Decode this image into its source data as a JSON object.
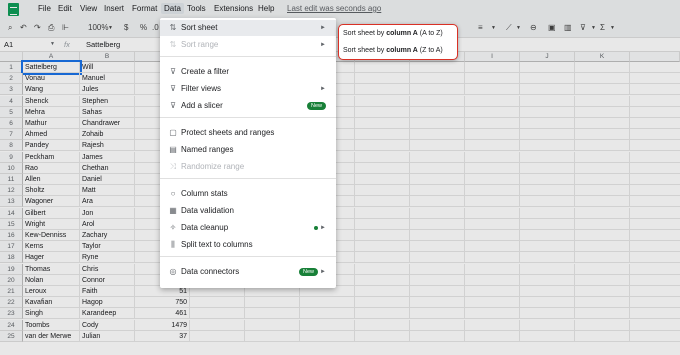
{
  "menubar": {
    "items": [
      "File",
      "Edit",
      "View",
      "Insert",
      "Format",
      "Data",
      "Tools",
      "Extensions",
      "Help"
    ],
    "last_edit": "Last edit was seconds ago"
  },
  "toolbar": {
    "zoom": "100%",
    "currency": "$",
    "percent": "%",
    "decimals": ".0"
  },
  "formula_bar": {
    "cell_ref": "A1",
    "fx": "fx",
    "value": "Sattelberg"
  },
  "grid": {
    "columns": [
      "A",
      "B",
      "C",
      "D",
      "E",
      "F",
      "G",
      "H",
      "I",
      "J",
      "K"
    ],
    "rows": [
      [
        "1",
        "Sattelberg",
        "Will",
        ""
      ],
      [
        "2",
        "Vonau",
        "Manuel",
        ""
      ],
      [
        "3",
        "Wang",
        "Jules",
        ""
      ],
      [
        "4",
        "Shenck",
        "Stephen",
        ""
      ],
      [
        "5",
        "Mehra",
        "Sahas",
        ""
      ],
      [
        "6",
        "Mathur",
        "Chandrawer",
        ""
      ],
      [
        "7",
        "Ahmed",
        "Zohaib",
        ""
      ],
      [
        "8",
        "Pandey",
        "Rajesh",
        ""
      ],
      [
        "9",
        "Peckham",
        "James",
        ""
      ],
      [
        "10",
        "Rao",
        "Chethan",
        ""
      ],
      [
        "11",
        "Allen",
        "Daniel",
        ""
      ],
      [
        "12",
        "Sholtz",
        "Matt",
        ""
      ],
      [
        "13",
        "Wagoner",
        "Ara",
        ""
      ],
      [
        "14",
        "Gilbert",
        "Jon",
        ""
      ],
      [
        "15",
        "Wright",
        "Arol",
        ""
      ],
      [
        "16",
        "Kew-Denniss",
        "Zachary",
        ""
      ],
      [
        "17",
        "Kerns",
        "Taylor",
        ""
      ],
      [
        "18",
        "Hager",
        "Ryne",
        ""
      ],
      [
        "19",
        "Thomas",
        "Chris",
        ""
      ],
      [
        "20",
        "Nolan",
        "Connor",
        "33"
      ],
      [
        "21",
        "Leroux",
        "Faith",
        "51"
      ],
      [
        "22",
        "Kavafian",
        "Hagop",
        "750"
      ],
      [
        "23",
        "Singh",
        "Karandeep",
        "461"
      ],
      [
        "24",
        "Toombs",
        "Cody",
        "1479"
      ],
      [
        "25",
        "van der Merwe",
        "Julian",
        "37"
      ]
    ]
  },
  "data_menu": {
    "items": [
      {
        "label": "Sort sheet",
        "icon": "sort-icon",
        "arrow": "►"
      },
      {
        "label": "Sort range",
        "icon": "sort-range-icon",
        "arrow": "►"
      },
      {
        "label": "Create a filter",
        "icon": "filter-icon"
      },
      {
        "label": "Filter views",
        "icon": "filter-views-icon",
        "arrow": "►"
      },
      {
        "label": "Add a slicer",
        "icon": "slicer-icon",
        "badge": "New"
      },
      {
        "label": "Protect sheets and ranges",
        "icon": "lock-icon"
      },
      {
        "label": "Named ranges",
        "icon": "named-ranges-icon"
      },
      {
        "label": "Randomize range",
        "icon": "shuffle-icon"
      },
      {
        "label": "Column stats",
        "icon": "lightbulb-icon"
      },
      {
        "label": "Data validation",
        "icon": "data-validation-icon"
      },
      {
        "label": "Data cleanup",
        "icon": "magic-wand-icon",
        "arrow": "►"
      },
      {
        "label": "Split text to columns",
        "icon": "split-icon"
      },
      {
        "label": "Data connectors",
        "icon": "database-icon",
        "badge": "New",
        "arrow": "►"
      }
    ]
  },
  "sort_submenu": {
    "az": {
      "prefix": "Sort sheet by ",
      "bold": "column A",
      "suffix": " (A to Z)"
    },
    "za": {
      "prefix": "Sort sheet by ",
      "bold": "column A",
      "suffix": " (Z to A)"
    }
  },
  "colors": {
    "highlight_border": "#d93025",
    "badge": "#188038",
    "sheets_green": "#0f9d58"
  }
}
